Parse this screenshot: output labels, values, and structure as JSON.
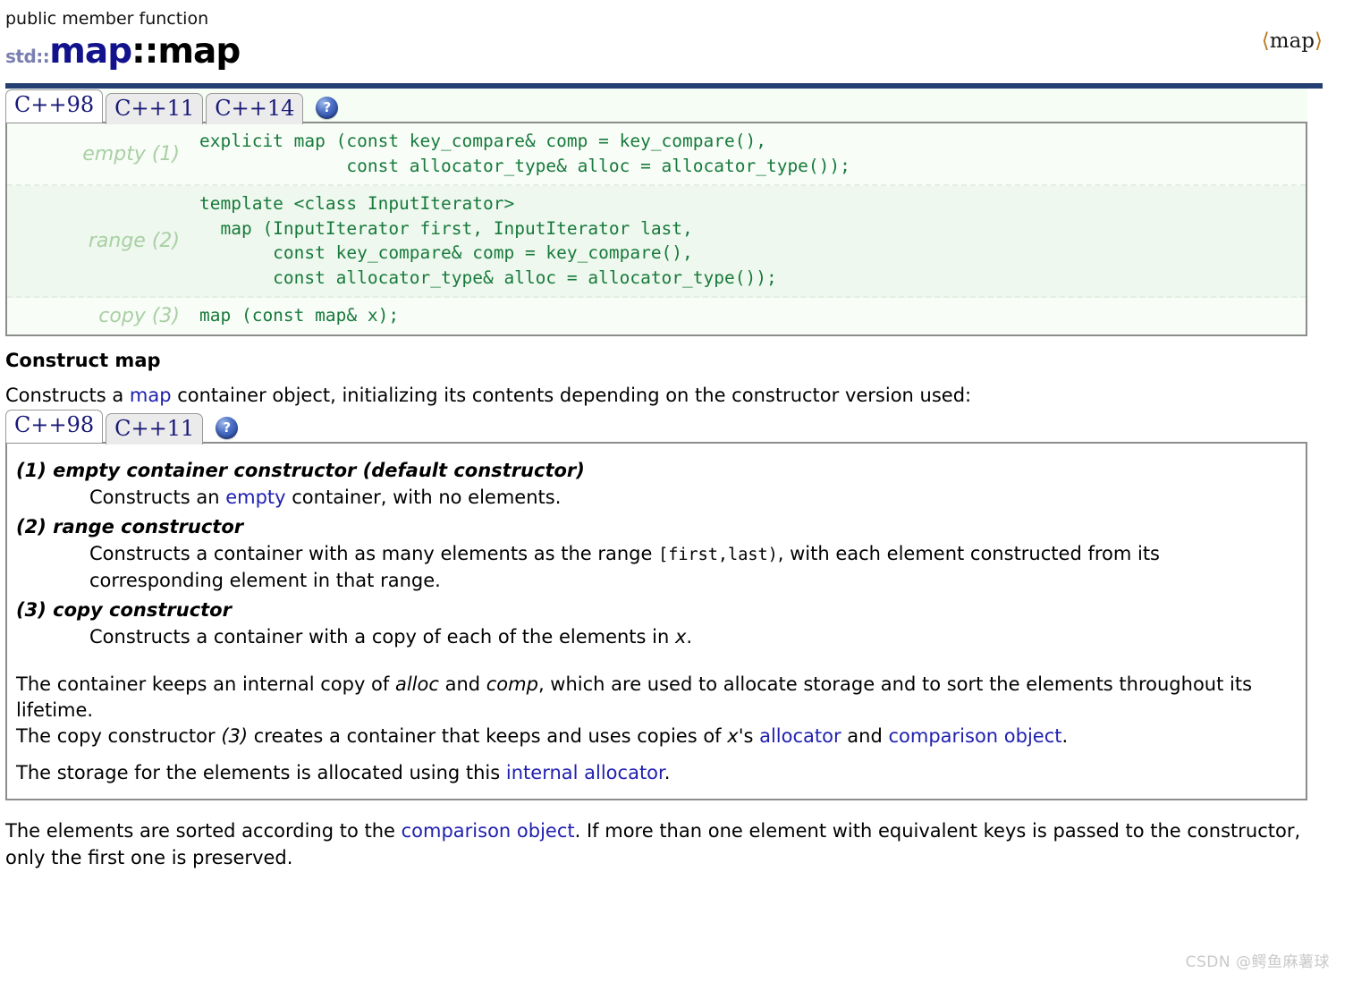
{
  "header": {
    "kind": "public member function",
    "namespace": "std::",
    "class_name": "map",
    "separator": "::",
    "function_name": "map",
    "include_open": "⟨",
    "include_name": "map",
    "include_close": "⟩",
    "rule_color": "#243f72"
  },
  "signature_panel": {
    "tabs": [
      {
        "label": "C++98",
        "active": true
      },
      {
        "label": "C++11",
        "active": false
      },
      {
        "label": "C++14",
        "active": false
      }
    ],
    "help_icon": "question-mark-icon",
    "help_glyph": "?",
    "rows": [
      {
        "label": "empty (1)",
        "code": "explicit map (const key_compare& comp = key_compare(),\n              const allocator_type& alloc = allocator_type());"
      },
      {
        "label": "range (2)",
        "code": "template <class InputIterator>\n  map (InputIterator first, InputIterator last,\n       const key_compare& comp = key_compare(),\n       const allocator_type& alloc = allocator_type());"
      },
      {
        "label": "copy (3)",
        "code": "map (const map& x);"
      }
    ],
    "code_color": "#177a3c",
    "label_color": "#a9cfa4",
    "background": "#f6fdf5"
  },
  "section": {
    "heading": "Construct map",
    "lead_before": "Constructs a ",
    "lead_link": "map",
    "lead_after": " container object, initializing its contents depending on the constructor version used:"
  },
  "description_panel": {
    "tabs": [
      {
        "label": "C++98",
        "active": true
      },
      {
        "label": "C++11",
        "active": false
      }
    ],
    "help_icon": "question-mark-icon",
    "help_glyph": "?",
    "constructors": [
      {
        "title": "(1) empty container constructor (default constructor)",
        "body_before": "Constructs an ",
        "body_link": "empty",
        "body_after": " container, with no elements."
      },
      {
        "title": "(2) range constructor",
        "body_before": "Constructs a container with as many elements as the range ",
        "body_mono": "[first,last)",
        "body_after": ", with each element constructed from its corresponding element in that range."
      },
      {
        "title": "(3) copy constructor",
        "body_before": "Constructs a container with a copy of each of the elements in ",
        "body_em": "x",
        "body_after": "."
      }
    ],
    "notes": [
      {
        "segments": [
          {
            "text": "The container keeps an internal copy of ",
            "style": "plain"
          },
          {
            "text": "alloc",
            "style": "italic"
          },
          {
            "text": " and ",
            "style": "plain"
          },
          {
            "text": "comp",
            "style": "italic"
          },
          {
            "text": ", which are used to allocate storage and to sort the elements throughout its lifetime.",
            "style": "plain"
          }
        ]
      },
      {
        "segments": [
          {
            "text": "The copy constructor ",
            "style": "plain"
          },
          {
            "text": "(3)",
            "style": "italic"
          },
          {
            "text": " creates a container that keeps and uses copies of ",
            "style": "plain"
          },
          {
            "text": "x",
            "style": "italic"
          },
          {
            "text": "'s ",
            "style": "plain"
          },
          {
            "text": "allocator",
            "style": "link"
          },
          {
            "text": " and ",
            "style": "plain"
          },
          {
            "text": "comparison object",
            "style": "link"
          },
          {
            "text": ".",
            "style": "plain"
          }
        ]
      },
      {
        "segments": [
          {
            "text": "The storage for the elements is allocated using this ",
            "style": "plain"
          },
          {
            "text": "internal allocator",
            "style": "link"
          },
          {
            "text": ".",
            "style": "plain"
          }
        ]
      }
    ]
  },
  "closing": {
    "before": "The elements are sorted according to the ",
    "link": "comparison object",
    "after": ". If more than one element with equivalent keys is passed to the constructor, only the first one is preserved."
  },
  "watermark": {
    "text": "CSDN @鳄鱼麻薯球",
    "color": "#c9c9c9"
  },
  "colors": {
    "link": "#2020b0",
    "title_class": "#12128c",
    "namespace": "#7a7fb0",
    "include_angle": "#b5791f"
  }
}
